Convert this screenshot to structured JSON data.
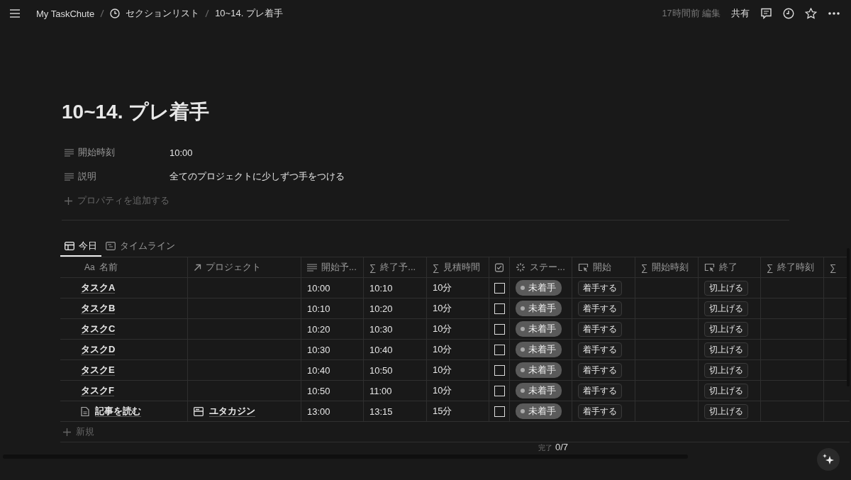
{
  "breadcrumb": [
    {
      "label": "My TaskChute"
    },
    {
      "label": "セクションリスト"
    },
    {
      "label": "10~14. プレ着手"
    }
  ],
  "topbar": {
    "edited": "17時間前 編集",
    "share": "共有"
  },
  "title": "10~14. プレ着手",
  "properties": [
    {
      "name": "開始時刻",
      "value": "10:00"
    },
    {
      "name": "説明",
      "value": "全てのプロジェクトに少しずつ手をつける"
    }
  ],
  "add_property": "プロパティを追加する",
  "tabs": [
    {
      "label": "今日",
      "selected": true
    },
    {
      "label": "タイムライン",
      "selected": false
    }
  ],
  "columns": [
    {
      "kind": "title",
      "prefix": "Aa",
      "label": "名前"
    },
    {
      "kind": "relation",
      "label": "プロジェクト"
    },
    {
      "kind": "text",
      "label": "開始予..."
    },
    {
      "kind": "formula",
      "prefix": "∑",
      "label": "終了予..."
    },
    {
      "kind": "formula",
      "prefix": "∑",
      "label": "見積時間"
    },
    {
      "kind": "checkbox"
    },
    {
      "kind": "status",
      "label": "ステー..."
    },
    {
      "kind": "button",
      "label": "開始"
    },
    {
      "kind": "formula",
      "prefix": "∑",
      "label": "開始時刻"
    },
    {
      "kind": "button",
      "label": "終了"
    },
    {
      "kind": "formula",
      "prefix": "∑",
      "label": "終了時刻"
    },
    {
      "kind": "formula",
      "prefix": "∑"
    }
  ],
  "rows": [
    {
      "name": "タスクA",
      "page_icon": false,
      "start": "10:00",
      "end": "10:10",
      "estimate": "10分",
      "checked": false,
      "status": "未着手",
      "start_button": "着手する",
      "end_button": "切上げる"
    },
    {
      "name": "タスクB",
      "page_icon": false,
      "start": "10:10",
      "end": "10:20",
      "estimate": "10分",
      "checked": false,
      "status": "未着手",
      "start_button": "着手する",
      "end_button": "切上げる"
    },
    {
      "name": "タスクC",
      "page_icon": false,
      "start": "10:20",
      "end": "10:30",
      "estimate": "10分",
      "checked": false,
      "status": "未着手",
      "start_button": "着手する",
      "end_button": "切上げる"
    },
    {
      "name": "タスクD",
      "page_icon": false,
      "start": "10:30",
      "end": "10:40",
      "estimate": "10分",
      "checked": false,
      "status": "未着手",
      "start_button": "着手する",
      "end_button": "切上げる"
    },
    {
      "name": "タスクE",
      "page_icon": false,
      "start": "10:40",
      "end": "10:50",
      "estimate": "10分",
      "checked": false,
      "status": "未着手",
      "start_button": "着手する",
      "end_button": "切上げる"
    },
    {
      "name": "タスクF",
      "page_icon": false,
      "start": "10:50",
      "end": "11:00",
      "estimate": "10分",
      "checked": false,
      "status": "未着手",
      "start_button": "着手する",
      "end_button": "切上げる"
    },
    {
      "name": "記事を読む",
      "page_icon": true,
      "project": "ユタカジン",
      "start": "13:00",
      "end": "13:15",
      "estimate": "15分",
      "checked": false,
      "status": "未着手",
      "start_button": "着手する",
      "end_button": "切上げる"
    }
  ],
  "new_row": "新規",
  "footer": {
    "label": "完了",
    "count": "0/7"
  }
}
